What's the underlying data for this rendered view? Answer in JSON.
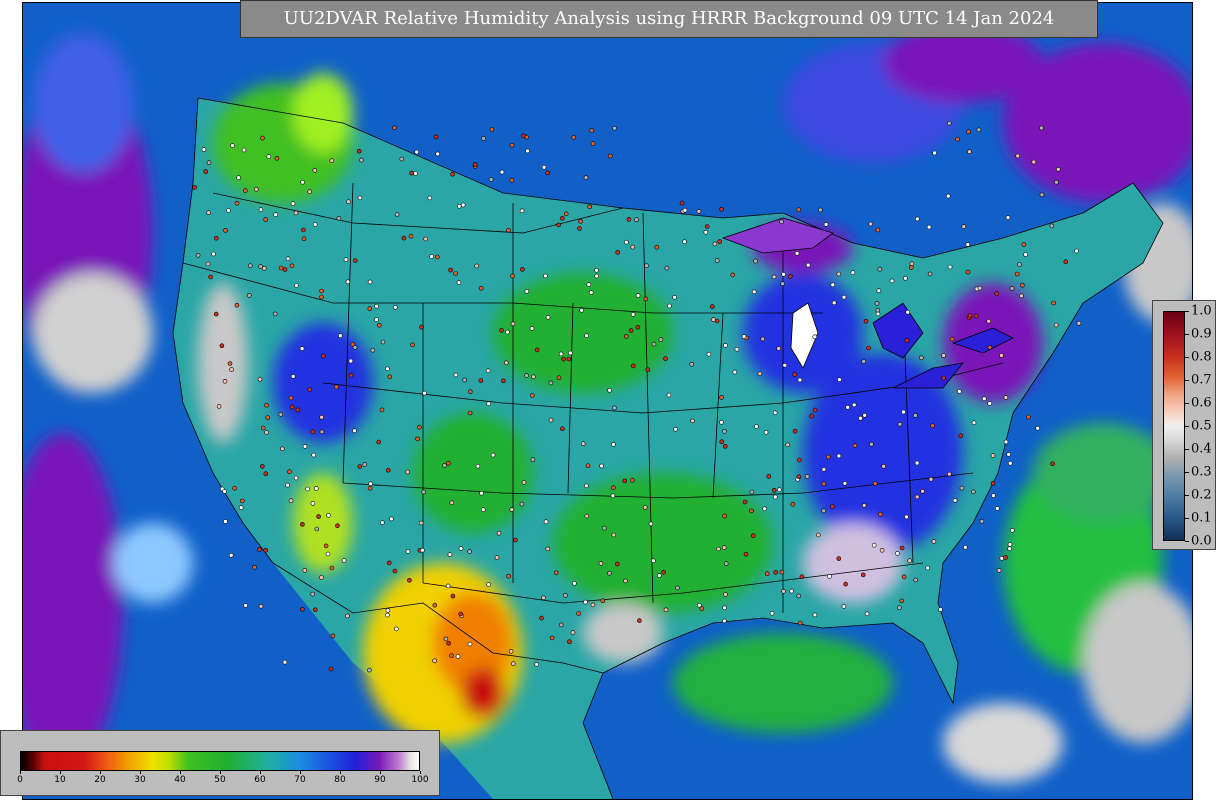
{
  "title": "UU2DVAR Relative Humidity Analysis using HRRR Background 09 UTC 14 Jan 2024",
  "colors": {
    "title_bg": "#8a8a8a",
    "ocean_blue": "#1060c8",
    "land_teal": "#2aa6a6",
    "moist_green": "#20b030",
    "dry_yellow": "#f0d000",
    "very_dry_red": "#c81010",
    "saturated_purple": "#7a18b8",
    "gray_high": "#c8c8c8"
  },
  "rh_colorbar": {
    "ticks": [
      "0",
      "10",
      "20",
      "30",
      "40",
      "50",
      "60",
      "70",
      "80",
      "90",
      "100"
    ],
    "min": 0,
    "max": 100
  },
  "station_colorbar": {
    "ticks": [
      "1.0",
      "0.9",
      "0.8",
      "0.7",
      "0.6",
      "0.5",
      "0.4",
      "0.3",
      "0.2",
      "0.1",
      "0.0"
    ],
    "min": 0.0,
    "max": 1.0
  }
}
